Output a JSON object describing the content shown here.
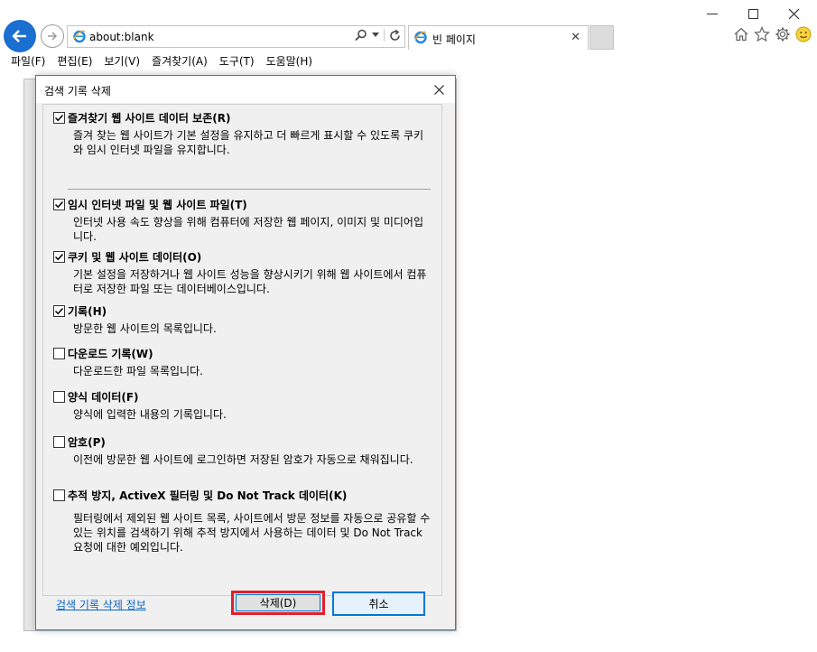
{
  "browser": {
    "address": "about:blank",
    "tab_title": "빈 페이지",
    "menu": [
      "파일(F)",
      "편집(E)",
      "보기(V)",
      "즐겨찾기(A)",
      "도구(T)",
      "도움말(H)"
    ]
  },
  "dialog": {
    "title": "검색 기록 삭제",
    "options": [
      {
        "label": "즐겨찾기 웹 사이트 데이터 보존(R)",
        "desc": "즐겨 찾는 웹 사이트가 기본 설정을 유지하고 더 빠르게 표시할 수 있도록 쿠키와 임시 인터넷 파일을 유지합니다.",
        "checked": true
      },
      {
        "label": "임시 인터넷 파일 및 웹 사이트 파일(T)",
        "desc": "인터넷 사용 속도 향상을 위해 컴퓨터에 저장한 웹 페이지, 이미지 및 미디어입니다.",
        "checked": true
      },
      {
        "label": "쿠키 및 웹 사이트 데이터(O)",
        "desc": "기본 설정을 저장하거나 웹 사이트 성능을 향상시키기 위해 웹 사이트에서 컴퓨터로 저장한 파일 또는 데이터베이스입니다.",
        "checked": true
      },
      {
        "label": "기록(H)",
        "desc": "방문한 웹 사이트의 목록입니다.",
        "checked": true
      },
      {
        "label": "다운로드 기록(W)",
        "desc": "다운로드한 파일 목록입니다.",
        "checked": false
      },
      {
        "label": "양식 데이터(F)",
        "desc": "양식에 입력한 내용의 기록입니다.",
        "checked": false
      },
      {
        "label": "암호(P)",
        "desc": "이전에 방문한 웹 사이트에 로그인하면 저장된 암호가 자동으로 채워집니다.",
        "checked": false
      },
      {
        "label": "추적 방지, ActiveX 필터링 및 Do Not Track 데이터(K)",
        "desc": "필터링에서 제외된 웹 사이트 목록, 사이트에서 방문 정보를 자동으로 공유할 수 있는 위치를 검색하기 위해 추적 방지에서 사용하는 데이터 및 Do Not Track 요청에 대한 예외입니다.",
        "checked": false
      }
    ],
    "info_link": "검색 기록 삭제 정보",
    "delete_label": "삭제(D)",
    "cancel_label": "취소"
  },
  "colors": {
    "accent": "#0078d7",
    "highlight": "#e0202a",
    "link": "#0b63c9"
  }
}
